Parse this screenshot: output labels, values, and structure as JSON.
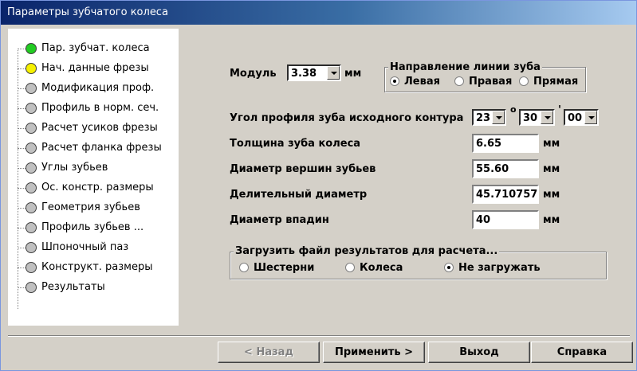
{
  "window": {
    "title": "Параметры зубчатого колеса"
  },
  "tree": {
    "items": [
      {
        "label": "Пар. зубчат. колеса",
        "status": "#22cc22"
      },
      {
        "label": "Нач. данные фрезы",
        "status": "#f5f000"
      },
      {
        "label": "Модификация проф.",
        "status": "#c0c0c0"
      },
      {
        "label": "Профиль в норм. сеч.",
        "status": "#c0c0c0"
      },
      {
        "label": "Расчет усиков фрезы",
        "status": "#c0c0c0"
      },
      {
        "label": "Расчет фланка фрезы",
        "status": "#c0c0c0"
      },
      {
        "label": "Углы зубьев",
        "status": "#c0c0c0"
      },
      {
        "label": "Ос. констр. размеры",
        "status": "#c0c0c0"
      },
      {
        "label": "Геометрия зубьев",
        "status": "#c0c0c0"
      },
      {
        "label": "Профиль зубьев ...",
        "status": "#c0c0c0"
      },
      {
        "label": "Шпоночный паз",
        "status": "#c0c0c0"
      },
      {
        "label": "Конструкт. размеры",
        "status": "#c0c0c0"
      },
      {
        "label": "Результаты",
        "status": "#c0c0c0"
      }
    ]
  },
  "module": {
    "label": "Модуль",
    "value": "3.38",
    "unit": "мм"
  },
  "direction": {
    "title": "Направление линии зуба",
    "options": [
      "Левая",
      "Правая",
      "Прямая"
    ],
    "selected": 0
  },
  "angle": {
    "label": "Угол профиля зуба исходного контура",
    "deg": "23",
    "deg_sym": "о",
    "min": "30",
    "min_sym": "'",
    "sec": "00"
  },
  "fields": [
    {
      "label": "Толщина зуба колеса",
      "value": "6.65",
      "unit": "мм"
    },
    {
      "label": "Диаметр вершин зубьев",
      "value": "55.60",
      "unit": "мм"
    },
    {
      "label": "Делительный диаметр",
      "value": "45.710757",
      "unit": "мм"
    },
    {
      "label": "Диаметр впадин",
      "value": "40",
      "unit": "мм"
    }
  ],
  "load": {
    "title": "Загрузить файл результатов для расчета...",
    "options": [
      "Шестерни",
      "Колеса",
      "Не загружать"
    ],
    "selected": 2
  },
  "buttons": {
    "back": "< Назад",
    "apply": "Применить >",
    "exit": "Выход",
    "help": "Справка"
  }
}
